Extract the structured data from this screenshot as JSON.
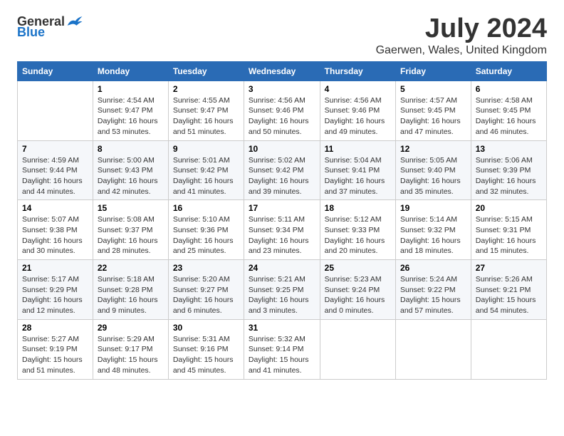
{
  "header": {
    "logo_general": "General",
    "logo_blue": "Blue",
    "month_year": "July 2024",
    "location": "Gaerwen, Wales, United Kingdom"
  },
  "weekdays": [
    "Sunday",
    "Monday",
    "Tuesday",
    "Wednesday",
    "Thursday",
    "Friday",
    "Saturday"
  ],
  "weeks": [
    [
      {
        "day": "",
        "info": ""
      },
      {
        "day": "1",
        "info": "Sunrise: 4:54 AM\nSunset: 9:47 PM\nDaylight: 16 hours\nand 53 minutes."
      },
      {
        "day": "2",
        "info": "Sunrise: 4:55 AM\nSunset: 9:47 PM\nDaylight: 16 hours\nand 51 minutes."
      },
      {
        "day": "3",
        "info": "Sunrise: 4:56 AM\nSunset: 9:46 PM\nDaylight: 16 hours\nand 50 minutes."
      },
      {
        "day": "4",
        "info": "Sunrise: 4:56 AM\nSunset: 9:46 PM\nDaylight: 16 hours\nand 49 minutes."
      },
      {
        "day": "5",
        "info": "Sunrise: 4:57 AM\nSunset: 9:45 PM\nDaylight: 16 hours\nand 47 minutes."
      },
      {
        "day": "6",
        "info": "Sunrise: 4:58 AM\nSunset: 9:45 PM\nDaylight: 16 hours\nand 46 minutes."
      }
    ],
    [
      {
        "day": "7",
        "info": "Sunrise: 4:59 AM\nSunset: 9:44 PM\nDaylight: 16 hours\nand 44 minutes."
      },
      {
        "day": "8",
        "info": "Sunrise: 5:00 AM\nSunset: 9:43 PM\nDaylight: 16 hours\nand 42 minutes."
      },
      {
        "day": "9",
        "info": "Sunrise: 5:01 AM\nSunset: 9:42 PM\nDaylight: 16 hours\nand 41 minutes."
      },
      {
        "day": "10",
        "info": "Sunrise: 5:02 AM\nSunset: 9:42 PM\nDaylight: 16 hours\nand 39 minutes."
      },
      {
        "day": "11",
        "info": "Sunrise: 5:04 AM\nSunset: 9:41 PM\nDaylight: 16 hours\nand 37 minutes."
      },
      {
        "day": "12",
        "info": "Sunrise: 5:05 AM\nSunset: 9:40 PM\nDaylight: 16 hours\nand 35 minutes."
      },
      {
        "day": "13",
        "info": "Sunrise: 5:06 AM\nSunset: 9:39 PM\nDaylight: 16 hours\nand 32 minutes."
      }
    ],
    [
      {
        "day": "14",
        "info": "Sunrise: 5:07 AM\nSunset: 9:38 PM\nDaylight: 16 hours\nand 30 minutes."
      },
      {
        "day": "15",
        "info": "Sunrise: 5:08 AM\nSunset: 9:37 PM\nDaylight: 16 hours\nand 28 minutes."
      },
      {
        "day": "16",
        "info": "Sunrise: 5:10 AM\nSunset: 9:36 PM\nDaylight: 16 hours\nand 25 minutes."
      },
      {
        "day": "17",
        "info": "Sunrise: 5:11 AM\nSunset: 9:34 PM\nDaylight: 16 hours\nand 23 minutes."
      },
      {
        "day": "18",
        "info": "Sunrise: 5:12 AM\nSunset: 9:33 PM\nDaylight: 16 hours\nand 20 minutes."
      },
      {
        "day": "19",
        "info": "Sunrise: 5:14 AM\nSunset: 9:32 PM\nDaylight: 16 hours\nand 18 minutes."
      },
      {
        "day": "20",
        "info": "Sunrise: 5:15 AM\nSunset: 9:31 PM\nDaylight: 16 hours\nand 15 minutes."
      }
    ],
    [
      {
        "day": "21",
        "info": "Sunrise: 5:17 AM\nSunset: 9:29 PM\nDaylight: 16 hours\nand 12 minutes."
      },
      {
        "day": "22",
        "info": "Sunrise: 5:18 AM\nSunset: 9:28 PM\nDaylight: 16 hours\nand 9 minutes."
      },
      {
        "day": "23",
        "info": "Sunrise: 5:20 AM\nSunset: 9:27 PM\nDaylight: 16 hours\nand 6 minutes."
      },
      {
        "day": "24",
        "info": "Sunrise: 5:21 AM\nSunset: 9:25 PM\nDaylight: 16 hours\nand 3 minutes."
      },
      {
        "day": "25",
        "info": "Sunrise: 5:23 AM\nSunset: 9:24 PM\nDaylight: 16 hours\nand 0 minutes."
      },
      {
        "day": "26",
        "info": "Sunrise: 5:24 AM\nSunset: 9:22 PM\nDaylight: 15 hours\nand 57 minutes."
      },
      {
        "day": "27",
        "info": "Sunrise: 5:26 AM\nSunset: 9:21 PM\nDaylight: 15 hours\nand 54 minutes."
      }
    ],
    [
      {
        "day": "28",
        "info": "Sunrise: 5:27 AM\nSunset: 9:19 PM\nDaylight: 15 hours\nand 51 minutes."
      },
      {
        "day": "29",
        "info": "Sunrise: 5:29 AM\nSunset: 9:17 PM\nDaylight: 15 hours\nand 48 minutes."
      },
      {
        "day": "30",
        "info": "Sunrise: 5:31 AM\nSunset: 9:16 PM\nDaylight: 15 hours\nand 45 minutes."
      },
      {
        "day": "31",
        "info": "Sunrise: 5:32 AM\nSunset: 9:14 PM\nDaylight: 15 hours\nand 41 minutes."
      },
      {
        "day": "",
        "info": ""
      },
      {
        "day": "",
        "info": ""
      },
      {
        "day": "",
        "info": ""
      }
    ]
  ]
}
